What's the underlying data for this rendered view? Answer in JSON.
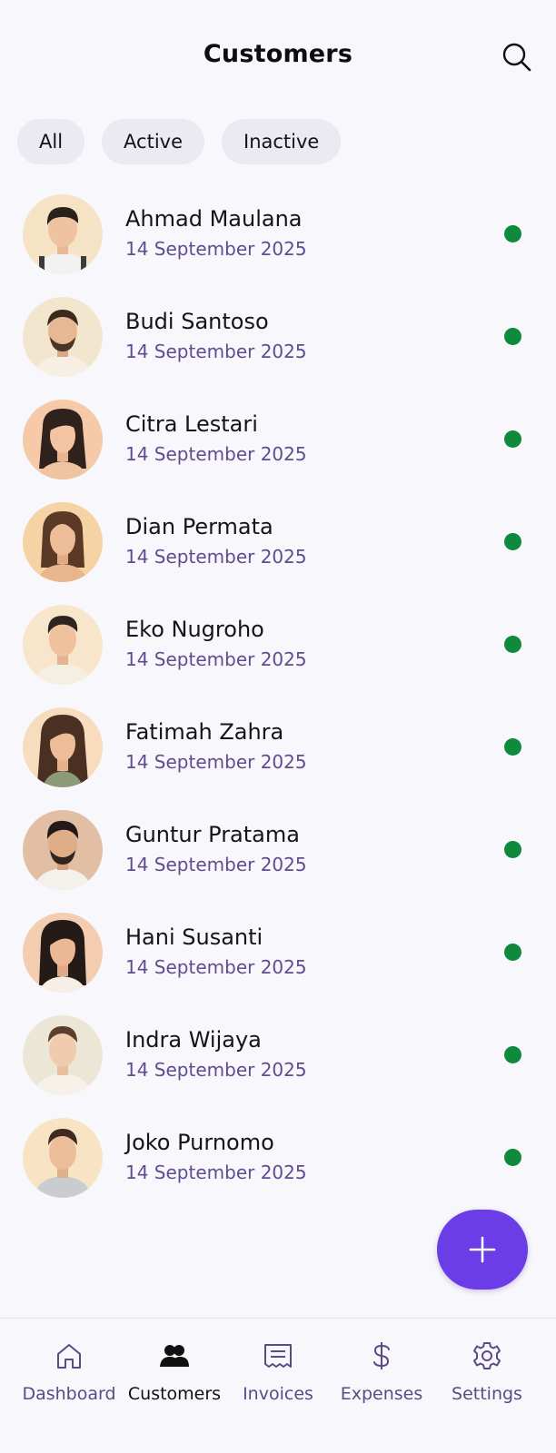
{
  "header": {
    "title": "Customers",
    "search_icon": "search-icon"
  },
  "filters": [
    {
      "label": "All"
    },
    {
      "label": "Active"
    },
    {
      "label": "Inactive"
    }
  ],
  "customers": [
    {
      "name": "Ahmad Maulana",
      "date": "14 September 2025",
      "status": "active"
    },
    {
      "name": "Budi Santoso",
      "date": "14 September 2025",
      "status": "active"
    },
    {
      "name": "Citra Lestari",
      "date": "14 September 2025",
      "status": "active"
    },
    {
      "name": "Dian Permata",
      "date": "14 September 2025",
      "status": "active"
    },
    {
      "name": "Eko Nugroho",
      "date": "14 September 2025",
      "status": "active"
    },
    {
      "name": "Fatimah Zahra",
      "date": "14 September 2025",
      "status": "active"
    },
    {
      "name": "Guntur Pratama",
      "date": "14 September 2025",
      "status": "active"
    },
    {
      "name": "Hani Susanti",
      "date": "14 September 2025",
      "status": "active"
    },
    {
      "name": "Indra Wijaya",
      "date": "14 September 2025",
      "status": "active"
    },
    {
      "name": "Joko Purnomo",
      "date": "14 September 2025",
      "status": "active"
    }
  ],
  "fab": {
    "icon": "plus-icon"
  },
  "nav": [
    {
      "label": "Dashboard",
      "icon": "home-icon"
    },
    {
      "label": "Customers",
      "icon": "users-icon"
    },
    {
      "label": "Invoices",
      "icon": "invoice-icon"
    },
    {
      "label": "Expenses",
      "icon": "dollar-icon"
    },
    {
      "label": "Settings",
      "icon": "gear-icon"
    }
  ],
  "colors": {
    "accent": "#6b3de6",
    "status_active": "#0f8a3c",
    "date_text": "#5f4c91",
    "chip_bg": "#ebe9f1",
    "background": "#f8f7fb"
  }
}
